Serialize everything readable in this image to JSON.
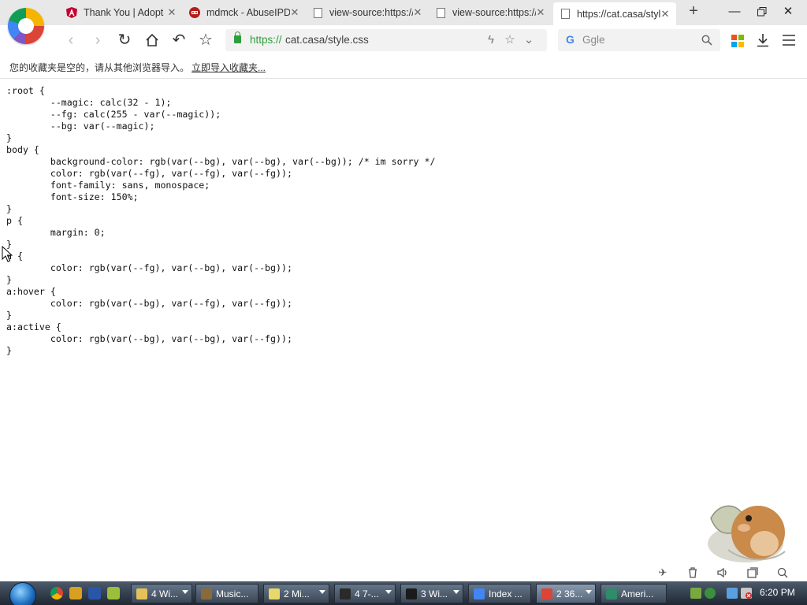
{
  "tabs": [
    {
      "title": "Thank You | Adopt",
      "favicon": "angular-icon",
      "active": false
    },
    {
      "title": "mdmck - AbuseIPDB",
      "favicon": "abuseipdb-icon",
      "active": false
    },
    {
      "title": "view-source:https://",
      "favicon": "document-icon",
      "active": false
    },
    {
      "title": "view-source:https://",
      "favicon": "document-icon",
      "active": false
    },
    {
      "title": "https://cat.casa/style",
      "favicon": "document-icon",
      "active": true
    }
  ],
  "address": {
    "scheme": "https://",
    "rest": "cat.casa/style.css"
  },
  "search": {
    "placeholder": "Ggle"
  },
  "bookmarks": {
    "empty_text": "您的收藏夹是空的，请从其他浏览器导入。",
    "import_link": "立即导入收藏夹..."
  },
  "source_lines": [
    ":root {",
    "        --magic: calc(32 - 1);",
    "        --fg: calc(255 - var(--magic));",
    "        --bg: var(--magic);",
    "}",
    "body {",
    "        background-color: rgb(var(--bg), var(--bg), var(--bg)); /* im sorry */",
    "        color: rgb(var(--fg), var(--fg), var(--fg));",
    "        font-family: sans, monospace;",
    "        font-size: 150%;",
    "}",
    "p {",
    "        margin: 0;",
    "}",
    "a {",
    "        color: rgb(var(--fg), var(--bg), var(--bg));",
    "}",
    "a:hover {",
    "        color: rgb(var(--bg), var(--fg), var(--fg));",
    "}",
    "a:active {",
    "        color: rgb(var(--bg), var(--bg), var(--fg));",
    "}"
  ],
  "taskbar": {
    "tasks": [
      {
        "label": "4 Wi...",
        "icon_color": "#e5c15a",
        "arrow": true
      },
      {
        "label": "Music...",
        "icon_color": "#8a6a3a",
        "arrow": false
      },
      {
        "label": "2 Mi...",
        "icon_color": "#e8d86a",
        "arrow": true
      },
      {
        "label": "4 7-...",
        "icon_color": "#2a2a2a",
        "arrow": true
      },
      {
        "label": "3 Wi...",
        "icon_color": "#1b1b1b",
        "arrow": true
      },
      {
        "label": "Index ...",
        "icon_color": "#4285f4",
        "arrow": false
      },
      {
        "label": "2 36...",
        "icon_color": "#db4437",
        "arrow": true,
        "active": true
      },
      {
        "label": "Ameri...",
        "icon_color": "#2d8c6a",
        "arrow": false
      }
    ],
    "clock": "6:20 PM"
  },
  "colors": {
    "accent_green": "#2e9e3b",
    "tab_bg": "#e8e8e8"
  }
}
